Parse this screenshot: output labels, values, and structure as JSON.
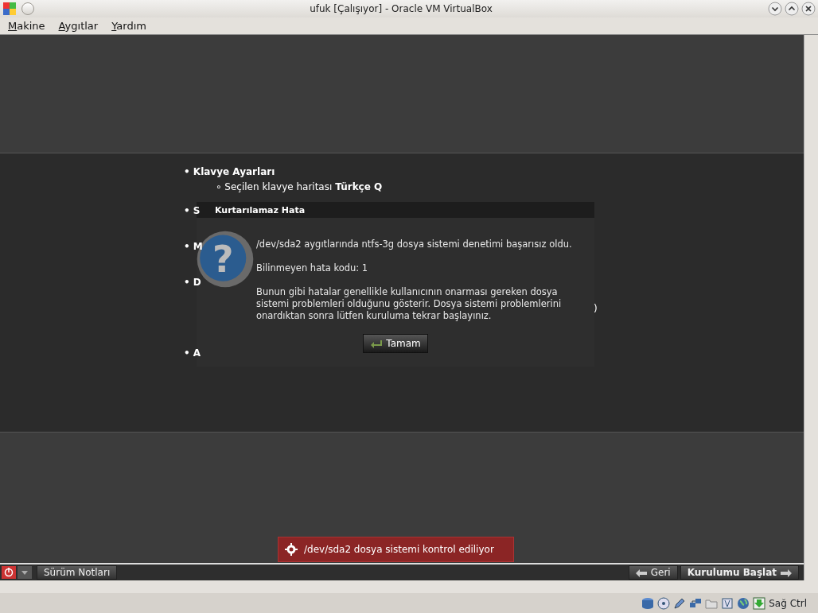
{
  "window": {
    "title": "ufuk [Çalışıyor] - Oracle VM VirtualBox"
  },
  "menu": [
    {
      "label": "Makine"
    },
    {
      "label": "Aygıtlar"
    },
    {
      "label": "Yardım"
    }
  ],
  "summary": [
    {
      "heading": "• Klavye Ayarları",
      "children": [
        {
          "text": "∘ Seçilen klavye haritası **Türkçe Q**"
        }
      ]
    },
    {
      "heading": "• S"
    },
    {
      "heading": "• M"
    },
    {
      "heading": "• D",
      "fragment": ")"
    },
    {
      "heading": "• A"
    }
  ],
  "dialog": {
    "title": "Kurtarılamaz Hata",
    "icon_glyph": "?",
    "paragraphs": [
      "/dev/sda2 aygıtlarında ntfs-3g dosya sistemi denetimi başarısız oldu.",
      "Bilinmeyen hata kodu: 1",
      "Bunun gibi hatalar genellikle kullanıcının onarması gereken dosya sistemi problemleri olduğunu gösterir. Dosya sistemi problemlerini onardıktan sonra lütfen kuruluma tekrar başlayınız."
    ],
    "button": "Tamam"
  },
  "notification": {
    "text": "/dev/sda2 dosya sistemi kontrol ediliyor"
  },
  "bottom_bar": {
    "left_button": "Sürüm Notları",
    "back_button": "Geri",
    "next_button": "Kurulumu Başlat"
  },
  "status_bar": {
    "host_key": "Sağ Ctrl"
  }
}
